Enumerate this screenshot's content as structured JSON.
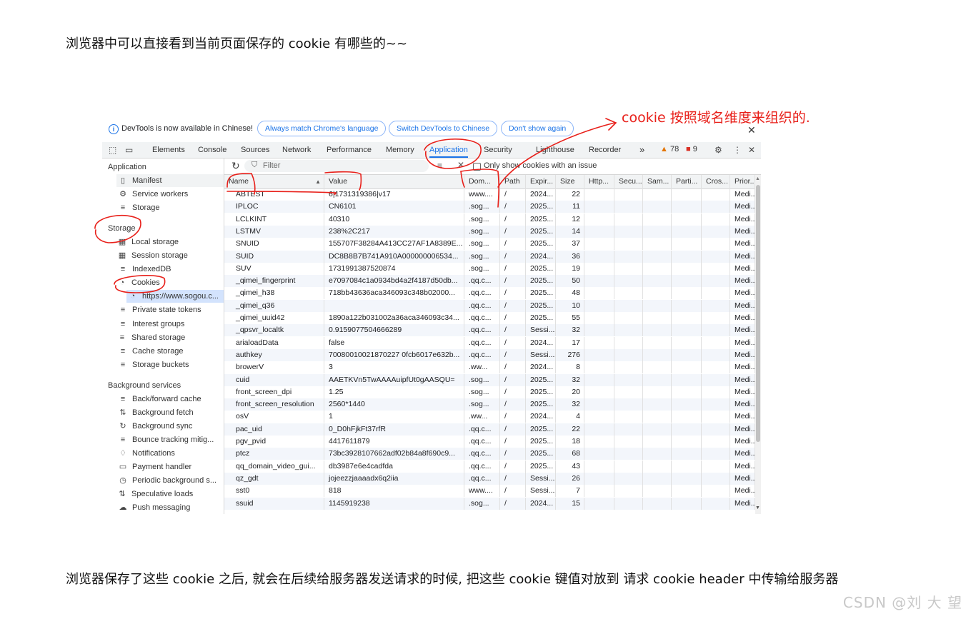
{
  "article": {
    "top_text": "浏览器中可以直接看到当前页面保存的 cookie 有哪些的~~",
    "bottom_text": "浏览器保存了这些 cookie 之后, 就会在后续给服务器发送请求的时候, 把这些 cookie 键值对放到 请求 cookie header 中传输给服务器",
    "watermark": "CSDN @刘 大 望"
  },
  "annotation": {
    "text": "cookie 按照域名维度来组织的.",
    "color": "#e8201a"
  },
  "infobar": {
    "message": "DevTools is now available in Chinese!",
    "btn_match": "Always match Chrome's language",
    "btn_switch": "Switch DevTools to Chinese",
    "btn_dismiss": "Don't show again",
    "close": "✕"
  },
  "toolbar": {
    "tabs": [
      "Elements",
      "Console",
      "Sources",
      "Network",
      "Performance",
      "Memory",
      "Application",
      "Security",
      "Lighthouse",
      "Recorder"
    ],
    "active_tab": "Application",
    "more": "»",
    "warnings": "78",
    "errors": "9"
  },
  "sidebar": {
    "application_head": "Application",
    "application_items": [
      "Manifest",
      "Service workers",
      "Storage"
    ],
    "storage_head": "Storage",
    "storage_items": [
      "Local storage",
      "Session storage",
      "IndexedDB",
      "Cookies",
      "https://www.sogou.c...",
      "Private state tokens",
      "Interest groups",
      "Shared storage",
      "Cache storage",
      "Storage buckets"
    ],
    "bg_head": "Background services",
    "bg_items": [
      "Back/forward cache",
      "Background fetch",
      "Background sync",
      "Bounce tracking mitig...",
      "Notifications",
      "Payment handler",
      "Periodic background s...",
      "Speculative loads",
      "Push messaging"
    ]
  },
  "filter": {
    "placeholder": "Filter",
    "checkbox_label": "Only show cookies with an issue"
  },
  "table": {
    "columns": [
      "Name",
      "Value",
      "Dom...",
      "Path",
      "Expir...",
      "Size",
      "Http...",
      "Secu...",
      "Sam...",
      "Parti...",
      "Cros...",
      "Prior..."
    ],
    "rows": [
      [
        "ABTEST",
        "6|1731319386|v17",
        "www....",
        "/",
        "2024...",
        "22",
        "Medi..."
      ],
      [
        "IPLOC",
        "CN6101",
        ".sog...",
        "/",
        "2025...",
        "11",
        "Medi..."
      ],
      [
        "LCLKINT",
        "40310",
        ".sog...",
        "/",
        "2025...",
        "12",
        "Medi..."
      ],
      [
        "LSTMV",
        "238%2C217",
        ".sog...",
        "/",
        "2025...",
        "14",
        "Medi..."
      ],
      [
        "SNUID",
        "155707F38284A413CC27AF1A8389E...",
        ".sog...",
        "/",
        "2025...",
        "37",
        "Medi..."
      ],
      [
        "SUID",
        "DC8B8B7B741A910A000000006534...",
        ".sog...",
        "/",
        "2024...",
        "36",
        "Medi..."
      ],
      [
        "SUV",
        "1731991387520874",
        ".sog...",
        "/",
        "2025...",
        "19",
        "Medi..."
      ],
      [
        "_qimei_fingerprint",
        "e7097084c1a0934bd4a2f4187d50db...",
        ".qq.c...",
        "/",
        "2025...",
        "50",
        "Medi..."
      ],
      [
        "_qimei_h38",
        "718bb43636aca346093c348b02000...",
        ".qq.c...",
        "/",
        "2025...",
        "48",
        "Medi..."
      ],
      [
        "_qimei_q36",
        "",
        ".qq.c...",
        "/",
        "2025...",
        "10",
        "Medi..."
      ],
      [
        "_qimei_uuid42",
        "1890a122b031002a36aca346093c34...",
        ".qq.c...",
        "/",
        "2025...",
        "55",
        "Medi..."
      ],
      [
        "_qpsvr_localtk",
        "0.9159077504666289",
        ".qq.c...",
        "/",
        "Sessi...",
        "32",
        "Medi..."
      ],
      [
        "arialoadData",
        "false",
        ".qq.c...",
        "/",
        "2024...",
        "17",
        "Medi..."
      ],
      [
        "authkey",
        "70080010021870227 0fcb6017e632b...",
        ".qq.c...",
        "/",
        "Sessi...",
        "276",
        "Medi..."
      ],
      [
        "browerV",
        "3",
        ".ww...",
        "/",
        "2024...",
        "8",
        "Medi..."
      ],
      [
        "cuid",
        "AAETKVn5TwAAAAuipfUt0gAASQU=",
        ".sog...",
        "/",
        "2025...",
        "32",
        "Medi..."
      ],
      [
        "front_screen_dpi",
        "1.25",
        ".sog...",
        "/",
        "2025...",
        "20",
        "Medi..."
      ],
      [
        "front_screen_resolution",
        "2560*1440",
        ".sog...",
        "/",
        "2025...",
        "32",
        "Medi..."
      ],
      [
        "osV",
        "1",
        ".ww...",
        "/",
        "2024...",
        "4",
        "Medi..."
      ],
      [
        "pac_uid",
        "0_D0hFjkFt37rfR",
        ".qq.c...",
        "/",
        "2025...",
        "22",
        "Medi..."
      ],
      [
        "pgv_pvid",
        "4417611879",
        ".qq.c...",
        "/",
        "2025...",
        "18",
        "Medi..."
      ],
      [
        "ptcz",
        "73bc3928107662adf02b84a8f690c9...",
        ".qq.c...",
        "/",
        "2025...",
        "68",
        "Medi..."
      ],
      [
        "qq_domain_video_gui...",
        "db3987e6e4cadfda",
        ".qq.c...",
        "/",
        "2025...",
        "43",
        "Medi..."
      ],
      [
        "qz_gdt",
        "jojeezzjaaaadx6q2iia",
        ".qq.c...",
        "/",
        "Sessi...",
        "26",
        "Medi..."
      ],
      [
        "sst0",
        "818",
        "www....",
        "/",
        "Sessi...",
        "7",
        "Medi..."
      ],
      [
        "ssuid",
        "1145919238",
        ".sog...",
        "/",
        "2024...",
        "15",
        "Medi..."
      ]
    ]
  }
}
